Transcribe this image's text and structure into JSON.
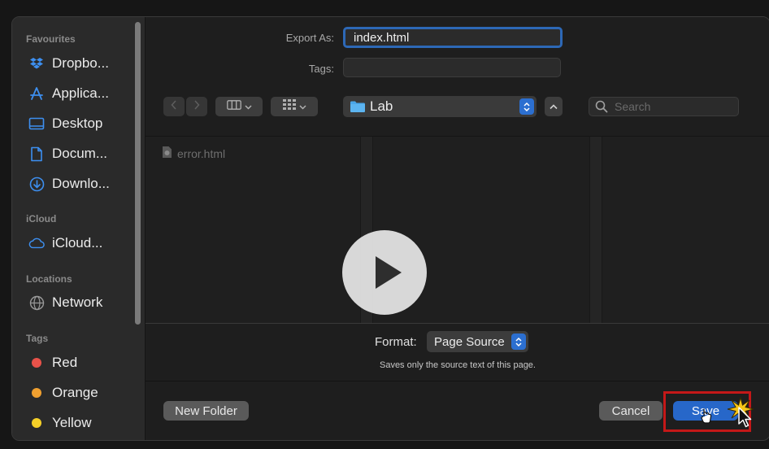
{
  "sidebar": {
    "sections": [
      {
        "title": "Favourites"
      },
      {
        "title": "iCloud"
      },
      {
        "title": "Locations"
      },
      {
        "title": "Tags"
      }
    ],
    "favourites": [
      {
        "label": "Dropbo...",
        "icon": "dropbox-icon"
      },
      {
        "label": "Applica...",
        "icon": "applications-icon"
      },
      {
        "label": "Desktop",
        "icon": "desktop-icon"
      },
      {
        "label": "Docum...",
        "icon": "document-icon"
      },
      {
        "label": "Downlo...",
        "icon": "download-icon"
      }
    ],
    "icloud": [
      {
        "label": "iCloud...",
        "icon": "cloud-icon"
      }
    ],
    "locations": [
      {
        "label": "Network",
        "icon": "globe-icon"
      }
    ],
    "tags": [
      {
        "label": "Red",
        "color": "#e8524a"
      },
      {
        "label": "Orange",
        "color": "#f0a030"
      },
      {
        "label": "Yellow",
        "color": "#f5d028"
      }
    ]
  },
  "form": {
    "export_label": "Export As:",
    "export_value": "index.html",
    "tags_label": "Tags:",
    "tags_value": ""
  },
  "toolbar": {
    "folder_name": "Lab",
    "search_placeholder": "Search"
  },
  "browser": {
    "files": [
      {
        "name": "error.html",
        "icon": "html-file-icon"
      }
    ]
  },
  "format": {
    "label": "Format:",
    "value": "Page Source",
    "hint": "Saves only the source text of this page."
  },
  "buttons": {
    "new_folder": "New Folder",
    "cancel": "Cancel",
    "save": "Save"
  },
  "overlay": {
    "play_icon": "play-icon",
    "highlight_color": "#c41818",
    "accent": "#2767c9"
  }
}
